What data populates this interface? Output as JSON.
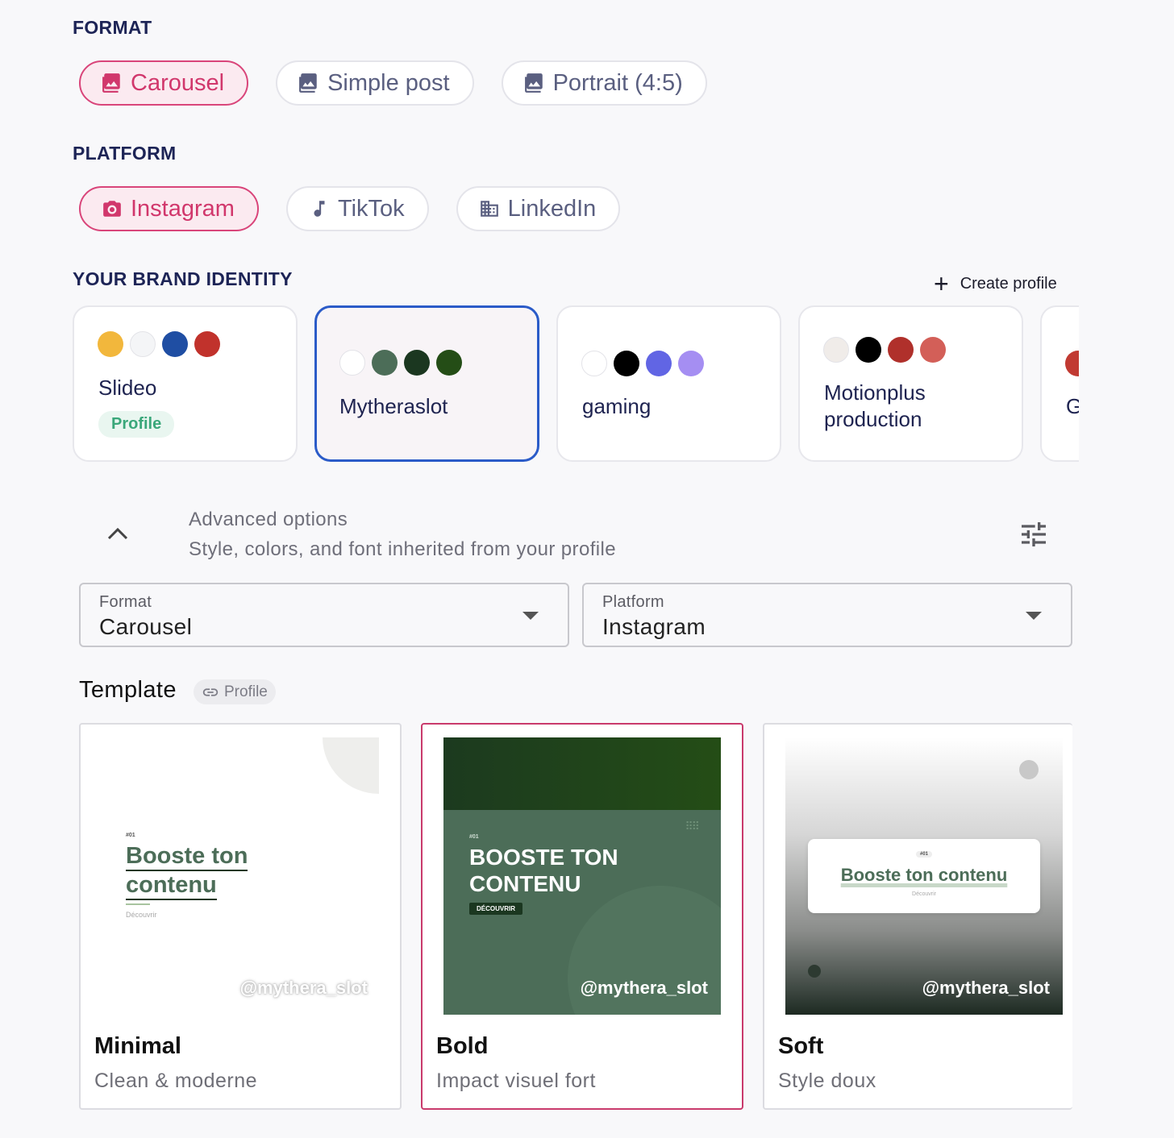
{
  "format_section": {
    "label": "FORMAT",
    "options": [
      {
        "label": "Carousel",
        "icon": "image-icon",
        "active": true
      },
      {
        "label": "Simple post",
        "icon": "image-icon",
        "active": false
      },
      {
        "label": "Portrait (4:5)",
        "icon": "image-icon",
        "active": false
      }
    ]
  },
  "platform_section": {
    "label": "PLATFORM",
    "options": [
      {
        "label": "Instagram",
        "icon": "camera-icon",
        "active": true
      },
      {
        "label": "TikTok",
        "icon": "music-note-icon",
        "active": false
      },
      {
        "label": "LinkedIn",
        "icon": "building-icon",
        "active": false
      }
    ]
  },
  "brand_section": {
    "label": "YOUR BRAND IDENTITY",
    "create_label": "Create profile",
    "profiles": [
      {
        "name": "Slideo",
        "badge": "Profile",
        "colors": [
          "#f2b73c",
          "#f4f5f7",
          "#1f4ea3",
          "#c1322c"
        ]
      },
      {
        "name": "Mytheraslot",
        "selected": true,
        "colors": [
          "#ffffff",
          "#4c6d58",
          "#1b3720",
          "#244d16"
        ]
      },
      {
        "name": "gaming",
        "colors": [
          "#ffffff",
          "#000000",
          "#6165e4",
          "#a58ef2"
        ]
      },
      {
        "name": "Motionplus production",
        "name_line1": "Motionplus",
        "name_line2": "production",
        "colors": [
          "#f0ece9",
          "#000000",
          "#b0302b",
          "#d35f58"
        ]
      },
      {
        "name": "G",
        "colors": [
          "#c13a32"
        ]
      }
    ]
  },
  "advanced": {
    "title": "Advanced options",
    "subtitle": "Style, colors, and font inherited from your profile"
  },
  "selects": {
    "format": {
      "label": "Format",
      "value": "Carousel"
    },
    "platform": {
      "label": "Platform",
      "value": "Instagram"
    }
  },
  "template_section": {
    "heading": "Template",
    "badge": "Profile",
    "templates": [
      {
        "name": "Minimal",
        "desc": "Clean & moderne",
        "preview": {
          "tag": "#01",
          "title_line1": "Booste ton",
          "title_line2": "contenu",
          "cta": "Découvrir",
          "handle": "@mythera_slot"
        }
      },
      {
        "name": "Bold",
        "desc": "Impact visuel fort",
        "selected": true,
        "preview": {
          "tag": "#01",
          "title_line1": "BOOSTE TON",
          "title_line2": "CONTENU",
          "cta": "DÉCOUVRIR",
          "handle": "@mythera_slot"
        }
      },
      {
        "name": "Soft",
        "desc": "Style doux",
        "preview": {
          "tag": "#01",
          "title": "Booste ton contenu",
          "cta": "Découvrir",
          "handle": "@mythera_slot"
        }
      }
    ]
  },
  "colors": {
    "accent": "#d9457a",
    "selected_border": "#2b5bc8",
    "heading": "#1d2456"
  }
}
